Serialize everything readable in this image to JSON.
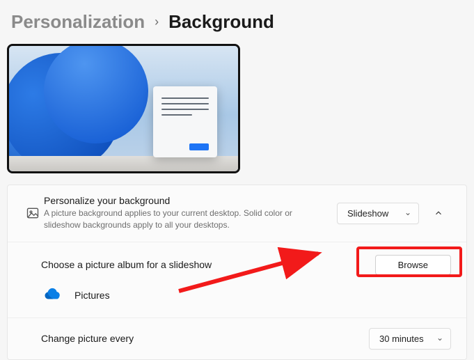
{
  "breadcrumb": {
    "parent": "Personalization",
    "current": "Background"
  },
  "personalize": {
    "title": "Personalize your background",
    "desc": "A picture background applies to your current desktop. Solid color or slideshow backgrounds apply to all your desktops.",
    "selected": "Slideshow"
  },
  "album": {
    "title": "Choose a picture album for a slideshow",
    "browse": "Browse",
    "folder": "Pictures"
  },
  "interval": {
    "title": "Change picture every",
    "selected": "30 minutes"
  }
}
